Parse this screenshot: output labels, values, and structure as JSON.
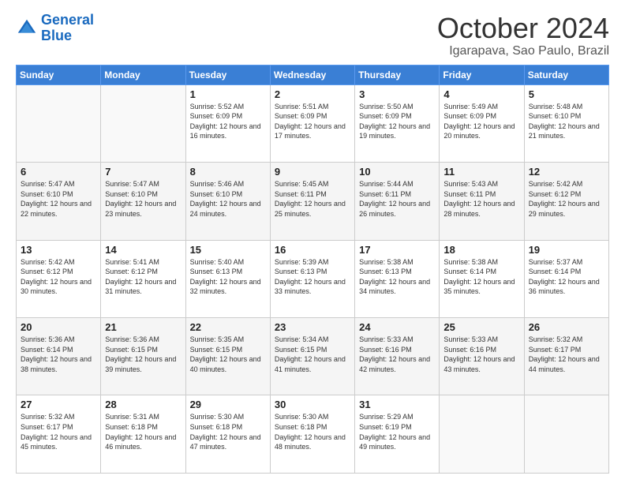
{
  "logo": {
    "line1": "General",
    "line2": "Blue"
  },
  "header": {
    "month_year": "October 2024",
    "location": "Igarapava, Sao Paulo, Brazil"
  },
  "weekdays": [
    "Sunday",
    "Monday",
    "Tuesday",
    "Wednesday",
    "Thursday",
    "Friday",
    "Saturday"
  ],
  "weeks": [
    [
      {
        "day": "",
        "sunrise": "",
        "sunset": "",
        "daylight": ""
      },
      {
        "day": "",
        "sunrise": "",
        "sunset": "",
        "daylight": ""
      },
      {
        "day": "1",
        "sunrise": "Sunrise: 5:52 AM",
        "sunset": "Sunset: 6:09 PM",
        "daylight": "Daylight: 12 hours and 16 minutes."
      },
      {
        "day": "2",
        "sunrise": "Sunrise: 5:51 AM",
        "sunset": "Sunset: 6:09 PM",
        "daylight": "Daylight: 12 hours and 17 minutes."
      },
      {
        "day": "3",
        "sunrise": "Sunrise: 5:50 AM",
        "sunset": "Sunset: 6:09 PM",
        "daylight": "Daylight: 12 hours and 19 minutes."
      },
      {
        "day": "4",
        "sunrise": "Sunrise: 5:49 AM",
        "sunset": "Sunset: 6:09 PM",
        "daylight": "Daylight: 12 hours and 20 minutes."
      },
      {
        "day": "5",
        "sunrise": "Sunrise: 5:48 AM",
        "sunset": "Sunset: 6:10 PM",
        "daylight": "Daylight: 12 hours and 21 minutes."
      }
    ],
    [
      {
        "day": "6",
        "sunrise": "Sunrise: 5:47 AM",
        "sunset": "Sunset: 6:10 PM",
        "daylight": "Daylight: 12 hours and 22 minutes."
      },
      {
        "day": "7",
        "sunrise": "Sunrise: 5:47 AM",
        "sunset": "Sunset: 6:10 PM",
        "daylight": "Daylight: 12 hours and 23 minutes."
      },
      {
        "day": "8",
        "sunrise": "Sunrise: 5:46 AM",
        "sunset": "Sunset: 6:10 PM",
        "daylight": "Daylight: 12 hours and 24 minutes."
      },
      {
        "day": "9",
        "sunrise": "Sunrise: 5:45 AM",
        "sunset": "Sunset: 6:11 PM",
        "daylight": "Daylight: 12 hours and 25 minutes."
      },
      {
        "day": "10",
        "sunrise": "Sunrise: 5:44 AM",
        "sunset": "Sunset: 6:11 PM",
        "daylight": "Daylight: 12 hours and 26 minutes."
      },
      {
        "day": "11",
        "sunrise": "Sunrise: 5:43 AM",
        "sunset": "Sunset: 6:11 PM",
        "daylight": "Daylight: 12 hours and 28 minutes."
      },
      {
        "day": "12",
        "sunrise": "Sunrise: 5:42 AM",
        "sunset": "Sunset: 6:12 PM",
        "daylight": "Daylight: 12 hours and 29 minutes."
      }
    ],
    [
      {
        "day": "13",
        "sunrise": "Sunrise: 5:42 AM",
        "sunset": "Sunset: 6:12 PM",
        "daylight": "Daylight: 12 hours and 30 minutes."
      },
      {
        "day": "14",
        "sunrise": "Sunrise: 5:41 AM",
        "sunset": "Sunset: 6:12 PM",
        "daylight": "Daylight: 12 hours and 31 minutes."
      },
      {
        "day": "15",
        "sunrise": "Sunrise: 5:40 AM",
        "sunset": "Sunset: 6:13 PM",
        "daylight": "Daylight: 12 hours and 32 minutes."
      },
      {
        "day": "16",
        "sunrise": "Sunrise: 5:39 AM",
        "sunset": "Sunset: 6:13 PM",
        "daylight": "Daylight: 12 hours and 33 minutes."
      },
      {
        "day": "17",
        "sunrise": "Sunrise: 5:38 AM",
        "sunset": "Sunset: 6:13 PM",
        "daylight": "Daylight: 12 hours and 34 minutes."
      },
      {
        "day": "18",
        "sunrise": "Sunrise: 5:38 AM",
        "sunset": "Sunset: 6:14 PM",
        "daylight": "Daylight: 12 hours and 35 minutes."
      },
      {
        "day": "19",
        "sunrise": "Sunrise: 5:37 AM",
        "sunset": "Sunset: 6:14 PM",
        "daylight": "Daylight: 12 hours and 36 minutes."
      }
    ],
    [
      {
        "day": "20",
        "sunrise": "Sunrise: 5:36 AM",
        "sunset": "Sunset: 6:14 PM",
        "daylight": "Daylight: 12 hours and 38 minutes."
      },
      {
        "day": "21",
        "sunrise": "Sunrise: 5:36 AM",
        "sunset": "Sunset: 6:15 PM",
        "daylight": "Daylight: 12 hours and 39 minutes."
      },
      {
        "day": "22",
        "sunrise": "Sunrise: 5:35 AM",
        "sunset": "Sunset: 6:15 PM",
        "daylight": "Daylight: 12 hours and 40 minutes."
      },
      {
        "day": "23",
        "sunrise": "Sunrise: 5:34 AM",
        "sunset": "Sunset: 6:15 PM",
        "daylight": "Daylight: 12 hours and 41 minutes."
      },
      {
        "day": "24",
        "sunrise": "Sunrise: 5:33 AM",
        "sunset": "Sunset: 6:16 PM",
        "daylight": "Daylight: 12 hours and 42 minutes."
      },
      {
        "day": "25",
        "sunrise": "Sunrise: 5:33 AM",
        "sunset": "Sunset: 6:16 PM",
        "daylight": "Daylight: 12 hours and 43 minutes."
      },
      {
        "day": "26",
        "sunrise": "Sunrise: 5:32 AM",
        "sunset": "Sunset: 6:17 PM",
        "daylight": "Daylight: 12 hours and 44 minutes."
      }
    ],
    [
      {
        "day": "27",
        "sunrise": "Sunrise: 5:32 AM",
        "sunset": "Sunset: 6:17 PM",
        "daylight": "Daylight: 12 hours and 45 minutes."
      },
      {
        "day": "28",
        "sunrise": "Sunrise: 5:31 AM",
        "sunset": "Sunset: 6:18 PM",
        "daylight": "Daylight: 12 hours and 46 minutes."
      },
      {
        "day": "29",
        "sunrise": "Sunrise: 5:30 AM",
        "sunset": "Sunset: 6:18 PM",
        "daylight": "Daylight: 12 hours and 47 minutes."
      },
      {
        "day": "30",
        "sunrise": "Sunrise: 5:30 AM",
        "sunset": "Sunset: 6:18 PM",
        "daylight": "Daylight: 12 hours and 48 minutes."
      },
      {
        "day": "31",
        "sunrise": "Sunrise: 5:29 AM",
        "sunset": "Sunset: 6:19 PM",
        "daylight": "Daylight: 12 hours and 49 minutes."
      },
      {
        "day": "",
        "sunrise": "",
        "sunset": "",
        "daylight": ""
      },
      {
        "day": "",
        "sunrise": "",
        "sunset": "",
        "daylight": ""
      }
    ]
  ]
}
